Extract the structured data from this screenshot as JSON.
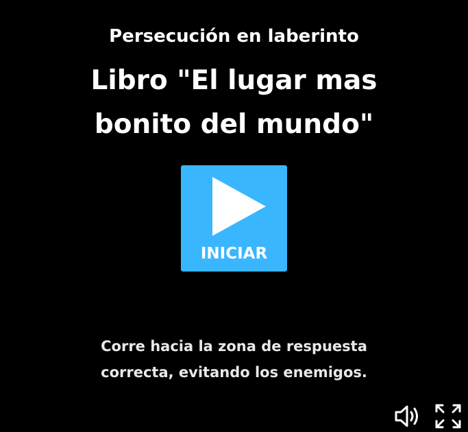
{
  "intro": {
    "game_type": "Persecución en laberinto",
    "title": "Libro \"El lugar mas bonito del mundo\"",
    "start_label": "INICIAR",
    "instructions": "Corre hacia la zona de respuesta correcta, evitando los enemigos."
  },
  "controls": {
    "volume_icon": "speaker-volume-icon",
    "fullscreen_icon": "fullscreen-expand-icon"
  },
  "colors": {
    "background": "#000000",
    "accent": "#3ab6fe",
    "text": "#ffffff"
  }
}
